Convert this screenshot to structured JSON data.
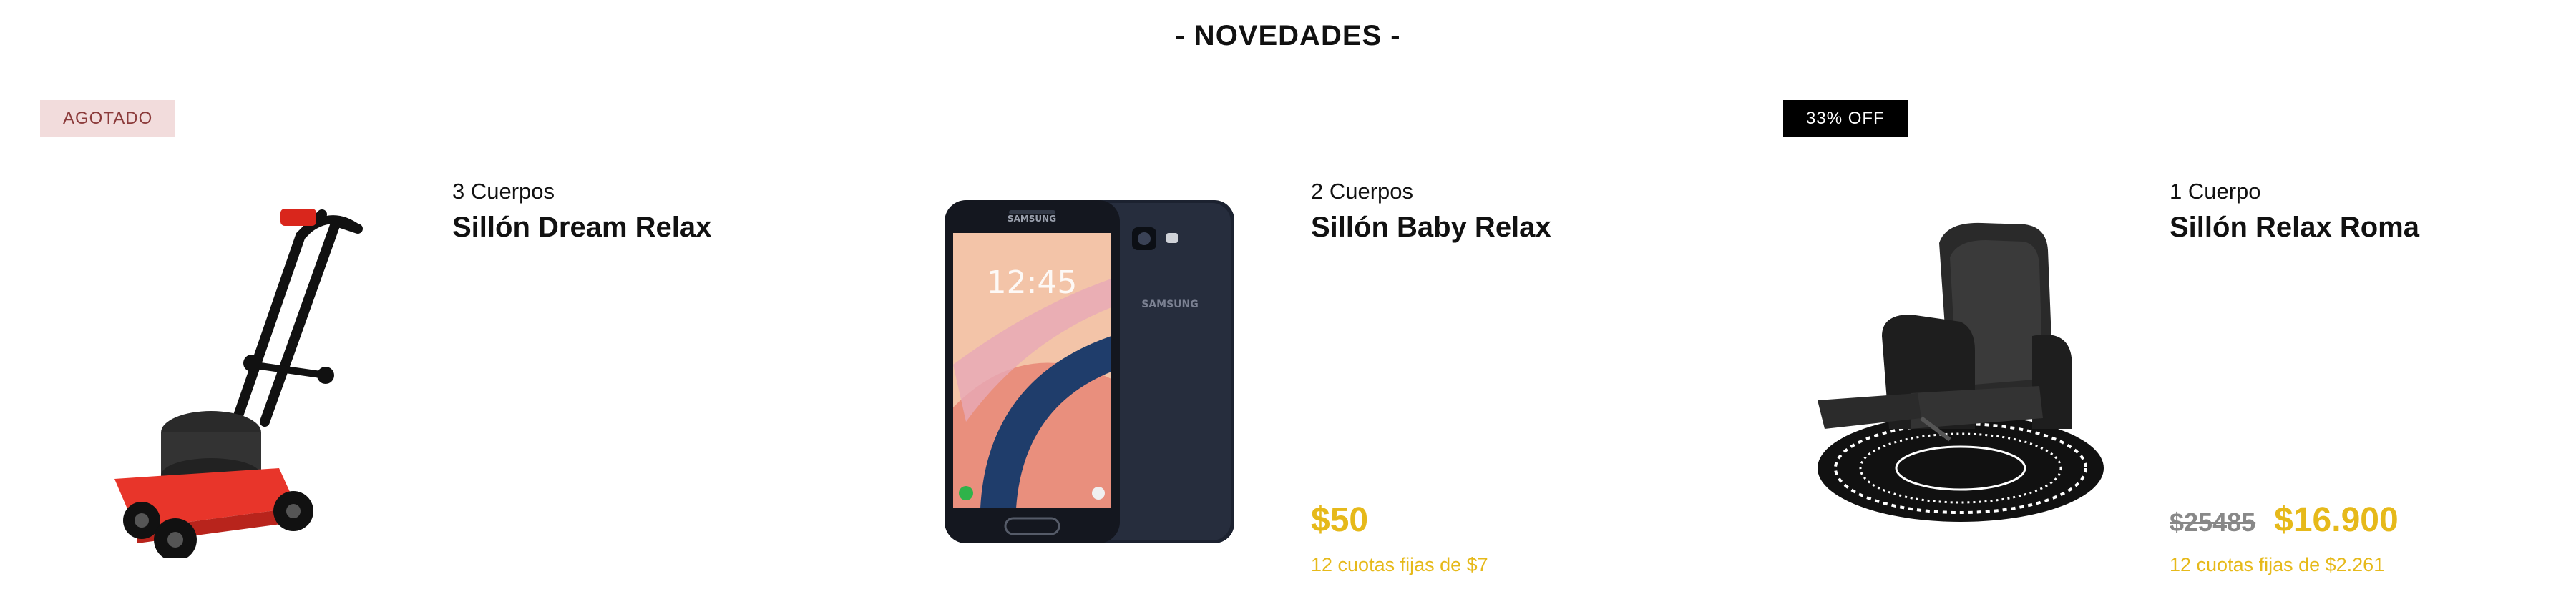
{
  "section": {
    "title": "- NOVEDADES -"
  },
  "colors": {
    "accent": "#e6b91a",
    "soldout_bg": "#f2dcdc",
    "soldout_text": "#8b3a3a",
    "discount_bg": "#000000"
  },
  "products": [
    {
      "badge": "AGOTADO",
      "subtitle": "3 Cuerpos",
      "name": "Sillón Dream Relax",
      "image_icon": "lawn-mower-image"
    },
    {
      "subtitle": "2 Cuerpos",
      "name": "Sillón Baby Relax",
      "price": "$50",
      "installments": "12 cuotas fijas de $7",
      "image_icon": "smartphone-image",
      "phone_time": "12:45",
      "phone_brand": "SAMSUNG"
    },
    {
      "badge": "33% OFF",
      "subtitle": "1 Cuerpo",
      "name": "Sillón Relax Roma",
      "old_price": "$25485",
      "price": "$16.900",
      "installments": "12 cuotas fijas de $2.261",
      "image_icon": "recliner-chair-image"
    }
  ]
}
